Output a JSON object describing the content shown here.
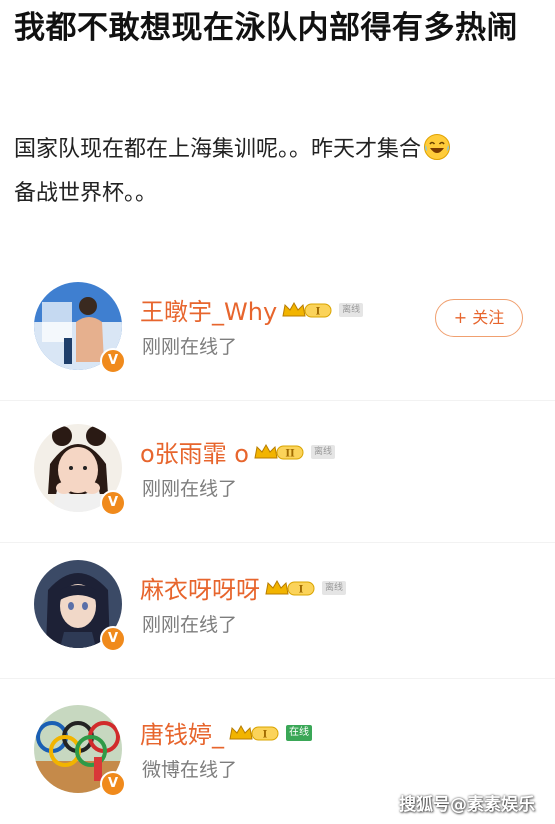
{
  "post": {
    "title": "我都不敢想现在泳队内部得有多热闹",
    "body": "国家队现在都在上海集训呢。。昨天才集合",
    "body_emoji": "laughing-tears-emoji",
    "body_line2": "备战世界杯。。"
  },
  "users": [
    {
      "name": "王暾宇_Why",
      "level": "I",
      "tag": "离线",
      "status": "刚刚在线了",
      "verified": "V"
    },
    {
      "name": "o张雨霏 o",
      "level": "II",
      "tag": "离线",
      "status": "刚刚在线了",
      "verified": "V"
    },
    {
      "name": "麻衣呀呀呀",
      "level": "I",
      "tag": "离线",
      "status": "刚刚在线了",
      "verified": "V"
    },
    {
      "name": "唐钱婷_",
      "level": "I",
      "tag": "在线",
      "status": "微博在线了",
      "verified": "V"
    }
  ],
  "follow_label": "+ 关注",
  "watermark": "搜狐号@素素娱乐",
  "colors": {
    "name": "#e7652d",
    "badge": "#f08a1c",
    "online": "#3aa757"
  }
}
